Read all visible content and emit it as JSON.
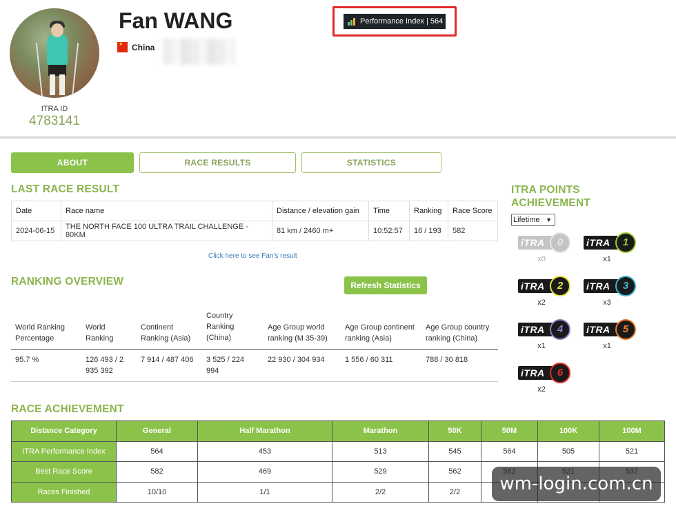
{
  "profile": {
    "name": "Fan WANG",
    "country": "China",
    "itra_id_label": "ITRA ID",
    "itra_id": "4783141",
    "performance_index_label": "Performance Index | 564"
  },
  "tabs": [
    {
      "label": "ABOUT",
      "active": true
    },
    {
      "label": "RACE RESULTS",
      "active": false
    },
    {
      "label": "STATISTICS",
      "active": false
    }
  ],
  "last_race": {
    "title": "LAST RACE RESULT",
    "columns": [
      "Date",
      "Race name",
      "Distance / elevation gain",
      "Time",
      "Ranking",
      "Race Score"
    ],
    "row": [
      "2024-06-15",
      "THE NORTH FACE 100 ULTRA TRAIL CHALLENGE - 80KM",
      "81 km / 2460 m+",
      "10:52:57",
      "16 / 193",
      "582"
    ],
    "link_text": "Click here to see Fan's result"
  },
  "ranking": {
    "title": "RANKING OVERVIEW",
    "refresh_label": "Refresh Statistics",
    "headers": [
      "World Ranking Percentage",
      "World Ranking",
      "Continent Ranking (Asia)",
      "Country Ranking (China)",
      "Age Group world ranking (M 35-39)",
      "Age Group continent ranking (Asia)",
      "Age Group country ranking (China)"
    ],
    "values": [
      "95.7 %",
      "126 493 / 2 935 392",
      "7 914 / 487 406",
      "3 525 / 224 994",
      "22 930 / 304 934",
      "1 556 / 60 311",
      "788 / 30 818"
    ]
  },
  "achievement": {
    "title": "RACE ACHIEVEMENT",
    "columns": [
      "Distance Category",
      "General",
      "Half Marathon",
      "Marathon",
      "50K",
      "50M",
      "100K",
      "100M"
    ],
    "rows": [
      [
        "ITRA Performance Index",
        "564",
        "453",
        "513",
        "545",
        "564",
        "505",
        "521"
      ],
      [
        "Best Race Score",
        "582",
        "469",
        "529",
        "562",
        "582",
        "521",
        "537"
      ],
      [
        "Races Finished",
        "10/10",
        "1/1",
        "2/2",
        "2/2",
        "",
        "",
        ""
      ]
    ]
  },
  "points": {
    "title_line1": "ITRA POINTS",
    "title_line2": "ACHIEVEMENT",
    "period": "Lifetime",
    "logo_text": "iTRA",
    "badges": [
      {
        "level": "0",
        "count": "x0",
        "color": "#e6e6e6",
        "earned": false
      },
      {
        "level": "1",
        "count": "x1",
        "color": "#9acd32",
        "earned": true
      },
      {
        "level": "2",
        "count": "x2",
        "color": "#e8e23a",
        "earned": true
      },
      {
        "level": "3",
        "count": "x3",
        "color": "#3fb6d8",
        "earned": true
      },
      {
        "level": "4",
        "count": "x1",
        "color": "#8a7fc6",
        "earned": true
      },
      {
        "level": "5",
        "count": "x1",
        "color": "#f07b2a",
        "earned": true
      },
      {
        "level": "6",
        "count": "x2",
        "color": "#e32c2c",
        "earned": true
      }
    ]
  },
  "watermark": "wm-login.com.cn"
}
